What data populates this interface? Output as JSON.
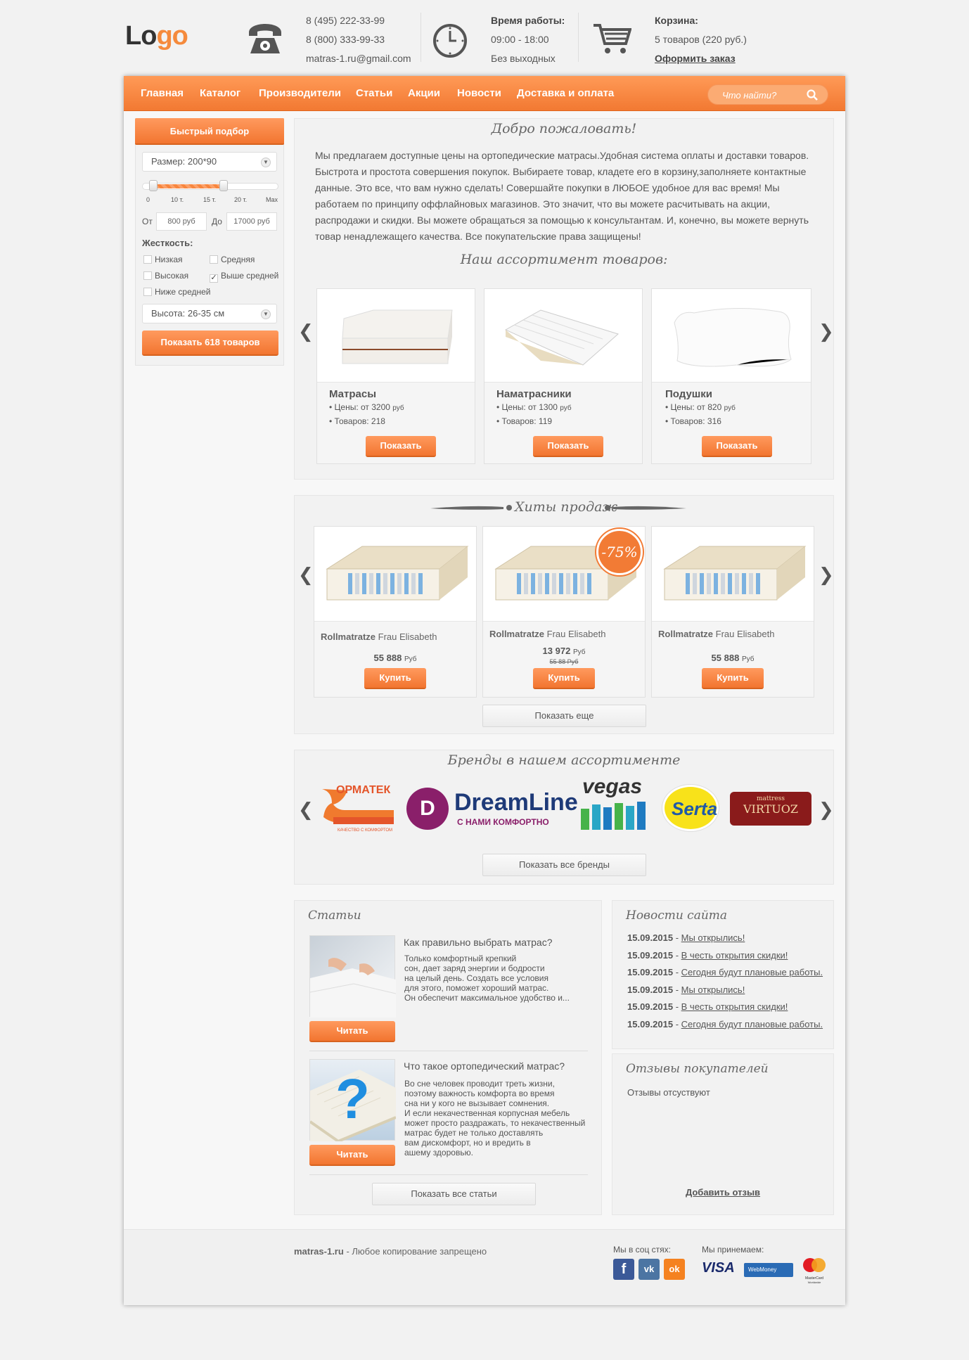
{
  "header": {
    "logo_a": "Lo",
    "logo_b": "go",
    "phones": [
      "8 (495) 222-33-99",
      "8 (800) 333-99-33",
      "matras-1.ru@gmail.com"
    ],
    "hours_title": "Время работы:",
    "hours": "09:00 - 18:00",
    "days": "Без выходных",
    "cart_title": "Корзина:",
    "cart_info": "5 товаров (220 руб.)",
    "cart_link": "Оформить заказ"
  },
  "nav": {
    "items": [
      "Главная",
      "Каталог",
      "Производители",
      "Статьи",
      "Акции",
      "Новости",
      "Доставка и оплата"
    ],
    "search_placeholder": "Что найти?"
  },
  "filter": {
    "title": "Быстрый подбор",
    "size": "Размер: 200*90",
    "ticks": [
      "0",
      "10 т.",
      "15 т.",
      "20 т.",
      "Max"
    ],
    "from_label": "От",
    "from": "800 руб",
    "to_label": "До",
    "to": "17000 руб",
    "hardness_title": "Жесткость:",
    "options": [
      {
        "label": "Низкая",
        "checked": false
      },
      {
        "label": "Средняя",
        "checked": false
      },
      {
        "label": "Высокая",
        "checked": false
      },
      {
        "label": "Выше средней",
        "checked": true
      },
      {
        "label": "Ниже средней",
        "checked": false
      }
    ],
    "height": "Высота: 26-35 см",
    "button": "Показать 618 товаров"
  },
  "welcome": {
    "title": "Добро пожаловать!",
    "text": "Мы предлагаем доступные цены на ортопедические матрасы.Удобная система оплаты и доставки товаров. Быстрота и простота совершения покупок. Выбираете товар, кладете его в корзину,заполняете контактные данные. Это все, что вам нужно сделать! Совершайте покупки в ЛЮБОЕ удобное для вас время! Мы работаем по принципу оффлайновых магазинов. Это значит, что вы можете расчитывать на акции, распродажи и скидки. Вы можете обращаться за помощью к консультантам. И, конечно, вы можете вернуть товар ненадлежащего качества. Все покупательские права защищены!",
    "assortment_title": "Наш ассортимент товаров:"
  },
  "categories": [
    {
      "name": "Матрасы",
      "price_label": "Цены: от 3200",
      "unit": "руб",
      "count": "Товаров: 218",
      "button": "Показать"
    },
    {
      "name": "Наматрасники",
      "price_label": "Цены: от 1300",
      "unit": "руб",
      "count": "Товаров: 119",
      "button": "Показать"
    },
    {
      "name": "Подушки",
      "price_label": "Цены: от 820",
      "unit": "руб",
      "count": "Товаров: 316",
      "button": "Показать"
    }
  ],
  "hits": {
    "title": "Хиты продаж",
    "items": [
      {
        "brand": "Rollmatratze",
        "model": "Frau Elisabeth",
        "price": "55 888",
        "unit": "Руб",
        "old": "",
        "badge": "",
        "button": "Купить"
      },
      {
        "brand": "Rollmatratze",
        "model": "Frau Elisabeth",
        "price": "13 972",
        "unit": "Руб",
        "old": "55 88 Руб",
        "badge": "-75%",
        "button": "Купить"
      },
      {
        "brand": "Rollmatratze",
        "model": "Frau Elisabeth",
        "price": "55 888",
        "unit": "Руб",
        "old": "",
        "badge": "",
        "button": "Купить"
      }
    ],
    "more": "Показать еще"
  },
  "brands": {
    "title": "Бренды в нашем ассортименте",
    "ormatek": "ОРМАТЕК",
    "ormatek_sub": "КАЧЕСТВО С КОМФОРТОМ",
    "dreamline": "DreamLine",
    "dreamline_sub": "С НАМИ КОМФОРТНО",
    "vegas": "vegas",
    "serta": "Serta",
    "virtuoz_top": "mattress",
    "virtuoz": "VIRTUOZ",
    "all": "Показать все бренды"
  },
  "articles": {
    "title": "Статьи",
    "items": [
      {
        "title": "Как правильно выбрать матрас?",
        "text": [
          "Только комфортный крепкий",
          "сон, дает заряд энергии и бодрости",
          "на целый день. Создать все условия",
          "для этого, поможет хороший матрас.",
          "Он обеспечит максимальное удобство и..."
        ],
        "button": "Читать"
      },
      {
        "title": "Что такое ортопедический матрас?",
        "text": [
          "Во сне человек проводит треть жизни,",
          "поэтому важность комфорта во время",
          "сна ни у кого не вызывает сомнения.",
          "И если некачественная корпусная мебель",
          "может просто раздражать, то некачественный",
          "матрас будет не только доставлять",
          "вам дискомфорт, но и вредить в",
          "ашему здоровью."
        ],
        "button": "Читать"
      }
    ],
    "all": "Показать все статьи"
  },
  "news": {
    "title": "Новости сайта",
    "items": [
      {
        "date": "15.09.2015",
        "text": "Мы открылись!"
      },
      {
        "date": "15.09.2015",
        "text": "В честь открытия скидки!"
      },
      {
        "date": "15.09.2015",
        "text": "Сегодня будут плановые работы."
      },
      {
        "date": "15.09.2015",
        "text": "Мы открылись!"
      },
      {
        "date": "15.09.2015",
        "text": "В честь открытия скидки!"
      },
      {
        "date": "15.09.2015",
        "text": "Сегодня будут плановые работы."
      }
    ]
  },
  "reviews": {
    "title": "Отзывы покупателей",
    "empty": "Отзывы отсуствуют",
    "add": "Добавить отзыв"
  },
  "footer": {
    "site": "matras-1.ru",
    "copy": "- Любое копирование запрещено",
    "social_title": "Мы в соц стях:",
    "pay_title": "Мы принемаем:",
    "fb": "f",
    "vk": "vk",
    "ok": "ok",
    "visa": "VISA",
    "webmoney": "WebMoney",
    "mc": "MasterCard",
    "mc_sub": "Worldwide"
  }
}
